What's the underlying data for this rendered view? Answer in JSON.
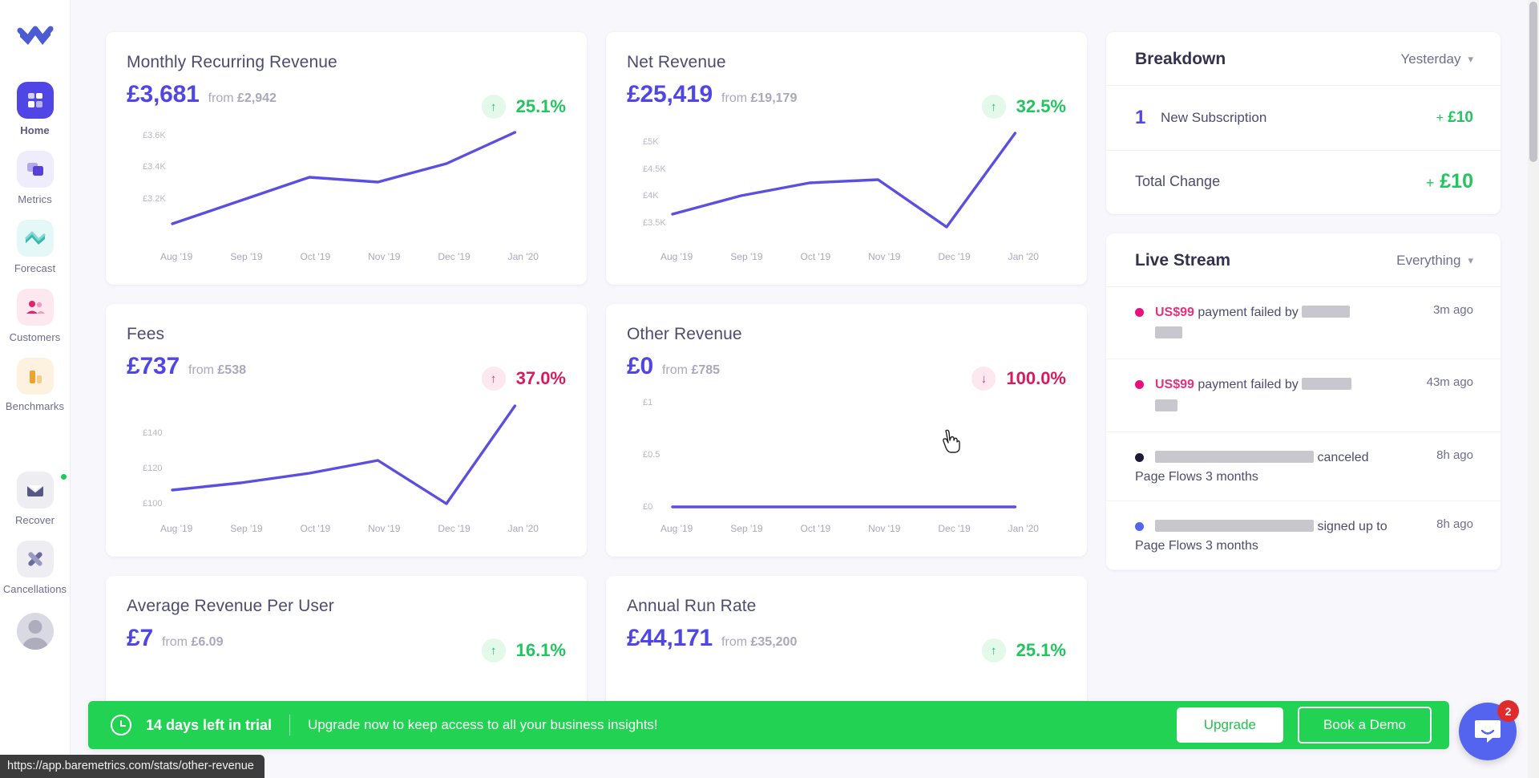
{
  "sidebar": {
    "brand": "baremetrics-logo",
    "items": [
      {
        "label": "Home",
        "icon": "grid-icon",
        "active": true,
        "dot": false
      },
      {
        "label": "Metrics",
        "icon": "layers-icon",
        "active": false,
        "dot": false
      },
      {
        "label": "Forecast",
        "icon": "chart-icon",
        "active": false,
        "dot": false
      },
      {
        "label": "Customers",
        "icon": "people-icon",
        "active": false,
        "dot": false
      },
      {
        "label": "Benchmarks",
        "icon": "bars-icon",
        "active": false,
        "dot": false
      },
      {
        "label": "Recover",
        "icon": "envelope-icon",
        "active": false,
        "dot": true
      },
      {
        "label": "Cancellations",
        "icon": "x-bandage-icon",
        "active": false,
        "dot": false
      }
    ]
  },
  "cards": [
    {
      "title": "Monthly Recurring Revenue",
      "value": "£3,681",
      "from_prefix": "from",
      "from_value": "£2,942",
      "delta": "25.1%",
      "direction": "up",
      "arrow": "↑"
    },
    {
      "title": "Net Revenue",
      "value": "£25,419",
      "from_prefix": "from",
      "from_value": "£19,179",
      "delta": "32.5%",
      "direction": "up",
      "arrow": "↑"
    },
    {
      "title": "Fees",
      "value": "£737",
      "from_prefix": "from",
      "from_value": "£538",
      "delta": "37.0%",
      "direction": "down",
      "arrow": "↑"
    },
    {
      "title": "Other Revenue",
      "value": "£0",
      "from_prefix": "from",
      "from_value": "£785",
      "delta": "100.0%",
      "direction": "down",
      "arrow": "↓"
    },
    {
      "title": "Average Revenue Per User",
      "value": "£7",
      "from_prefix": "from",
      "from_value": "£6.09",
      "delta": "16.1%",
      "direction": "up",
      "arrow": "↑"
    },
    {
      "title": "Annual Run Rate",
      "value": "£44,171",
      "from_prefix": "from",
      "from_value": "£35,200",
      "delta": "25.1%",
      "direction": "up",
      "arrow": "↑"
    }
  ],
  "chart_data": [
    {
      "type": "line",
      "title": "Monthly Recurring Revenue",
      "x": [
        "Aug '19",
        "Sep '19",
        "Oct '19",
        "Nov '19",
        "Dec '19",
        "Jan '20"
      ],
      "values": [
        3080,
        3230,
        3390,
        3360,
        3480,
        3681
      ],
      "yticks": [
        "£3.6K",
        "£3.4K",
        "£3.2K"
      ],
      "ytick_values": [
        3600,
        3400,
        3200
      ],
      "ylim": [
        3000,
        3700
      ],
      "xlabel": "",
      "ylabel": "",
      "grid": false,
      "legend": "none"
    },
    {
      "type": "line",
      "title": "Net Revenue",
      "x": [
        "Aug '19",
        "Sep '19",
        "Oct '19",
        "Nov '19",
        "Dec '19",
        "Jan '20"
      ],
      "values": [
        3720,
        4150,
        4430,
        4470,
        3480,
        5210
      ],
      "yticks": [
        "£5K",
        "£4.5K",
        "£4K",
        "£3.5K"
      ],
      "ytick_values": [
        5000,
        4500,
        4000,
        3500
      ],
      "ylim": [
        3350,
        5350
      ],
      "xlabel": "",
      "ylabel": "",
      "grid": false,
      "legend": "none"
    },
    {
      "type": "line",
      "title": "Fees",
      "x": [
        "Aug '19",
        "Sep '19",
        "Oct '19",
        "Nov '19",
        "Dec '19",
        "Jan '20"
      ],
      "values": [
        110,
        116,
        125,
        133,
        100,
        152
      ],
      "yticks": [
        "£140",
        "£120",
        "£100"
      ],
      "ytick_values": [
        140,
        120,
        100
      ],
      "ylim": [
        96,
        156
      ],
      "xlabel": "",
      "ylabel": "",
      "grid": false,
      "legend": "none"
    },
    {
      "type": "line",
      "title": "Other Revenue",
      "x": [
        "Aug '19",
        "Sep '19",
        "Oct '19",
        "Nov '19",
        "Dec '19",
        "Jan '20"
      ],
      "values": [
        0,
        0,
        0,
        0,
        0,
        0
      ],
      "yticks": [
        "£1",
        "£0.5",
        "£0"
      ],
      "ytick_values": [
        1,
        0.5,
        0
      ],
      "ylim": [
        0,
        1
      ],
      "xlabel": "",
      "ylabel": "",
      "grid": false,
      "legend": "none"
    }
  ],
  "breakdown": {
    "title": "Breakdown",
    "filter": "Yesterday",
    "rows": [
      {
        "count": "1",
        "label": "New Subscription",
        "plus": "+",
        "amount": "£10"
      }
    ],
    "total_label": "Total Change",
    "total_plus": "+",
    "total_amount": "£10"
  },
  "live_stream": {
    "title": "Live Stream",
    "filter": "Everything",
    "items": [
      {
        "dot_color": "#e5127d",
        "amount": "US$99",
        "text": "payment failed by",
        "redacted_w": 60,
        "redacted2_w": 34,
        "time": "3m ago",
        "sub": ""
      },
      {
        "dot_color": "#e5127d",
        "amount": "US$99",
        "text": "payment failed by",
        "redacted_w": 62,
        "redacted2_w": 28,
        "time": "43m ago",
        "sub": ""
      },
      {
        "dot_color": "#1d1b38",
        "amount": "",
        "text": "canceled",
        "redacted_w": 198,
        "redacted2_w": 0,
        "time": "8h ago",
        "sub": "Page Flows 3 months"
      },
      {
        "dot_color": "#5464ef",
        "amount": "",
        "text": "signed up to",
        "redacted_w": 198,
        "redacted2_w": 0,
        "time": "8h ago",
        "sub": "Page Flows 3 months"
      }
    ]
  },
  "banner": {
    "icon": "clock-icon",
    "days_left": "14 days left in trial",
    "message": "Upgrade now to keep access to all your business insights!",
    "upgrade_label": "Upgrade",
    "demo_label": "Book a Demo"
  },
  "intercom": {
    "badge": "2",
    "icon": "chat-smile-icon"
  },
  "status_bar": {
    "url": "https://app.baremetrics.com/stats/other-revenue"
  },
  "colors": {
    "accent": "#4f46e5",
    "positive": "#22c55e",
    "negative": "#d81b60",
    "banner": "#22d253",
    "line": "#5a4fe0"
  }
}
